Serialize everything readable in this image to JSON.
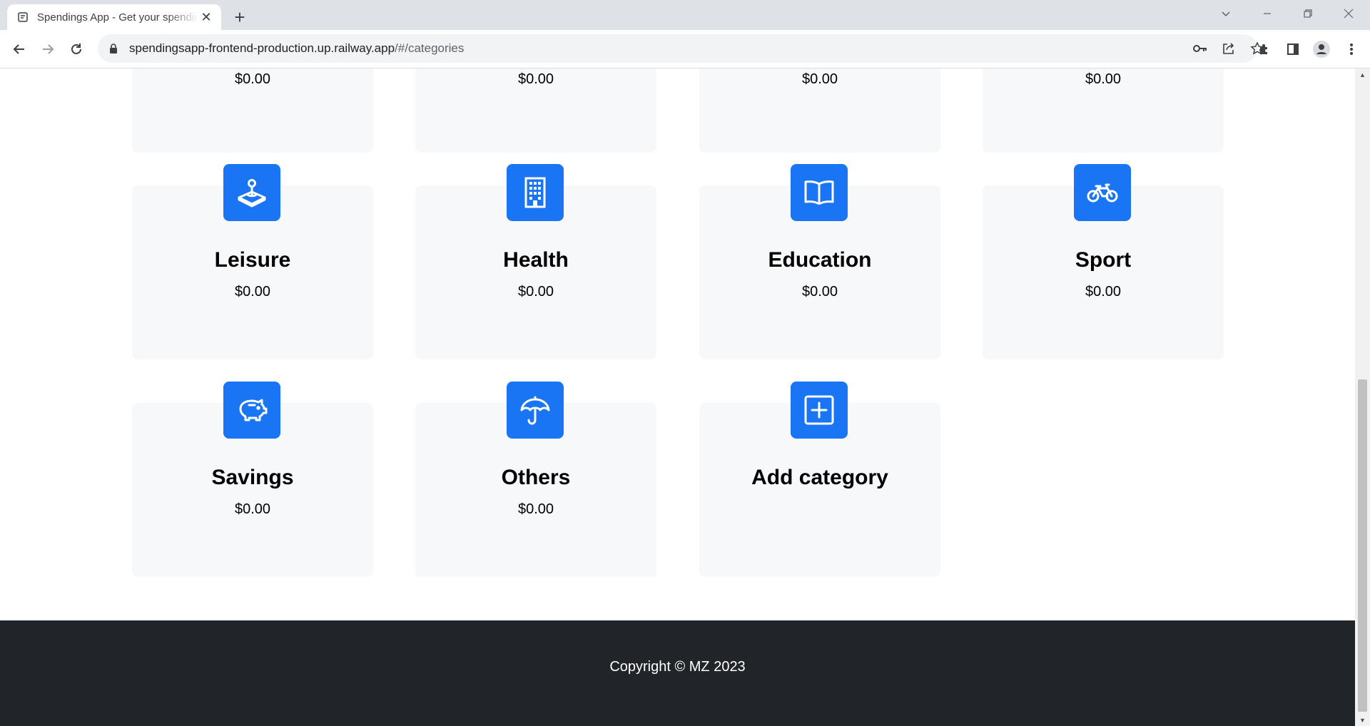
{
  "browser": {
    "tab_title": "Spendings App - Get your spendings",
    "new_tab_label": "+",
    "url_host": "spendingsapp-frontend-production.up.railway.app",
    "url_path": "/#/categories"
  },
  "top_row_amounts": [
    "$0.00",
    "$0.00",
    "$0.00",
    "$0.00"
  ],
  "categories": [
    {
      "name": "Leisure",
      "amount": "$0.00",
      "icon": "joystick-icon"
    },
    {
      "name": "Health",
      "amount": "$0.00",
      "icon": "hospital-building-icon"
    },
    {
      "name": "Education",
      "amount": "$0.00",
      "icon": "open-book-icon"
    },
    {
      "name": "Sport",
      "amount": "$0.00",
      "icon": "bicycle-icon"
    },
    {
      "name": "Savings",
      "amount": "$0.00",
      "icon": "piggy-bank-icon"
    },
    {
      "name": "Others",
      "amount": "$0.00",
      "icon": "umbrella-icon"
    }
  ],
  "add_category": {
    "label": "Add category",
    "icon": "plus-square-icon"
  },
  "footer": {
    "copyright": "Copyright © MZ 2023"
  },
  "colors": {
    "accent": "#1a75f5",
    "card_bg": "#f7f8fa",
    "footer_bg": "#212529"
  }
}
